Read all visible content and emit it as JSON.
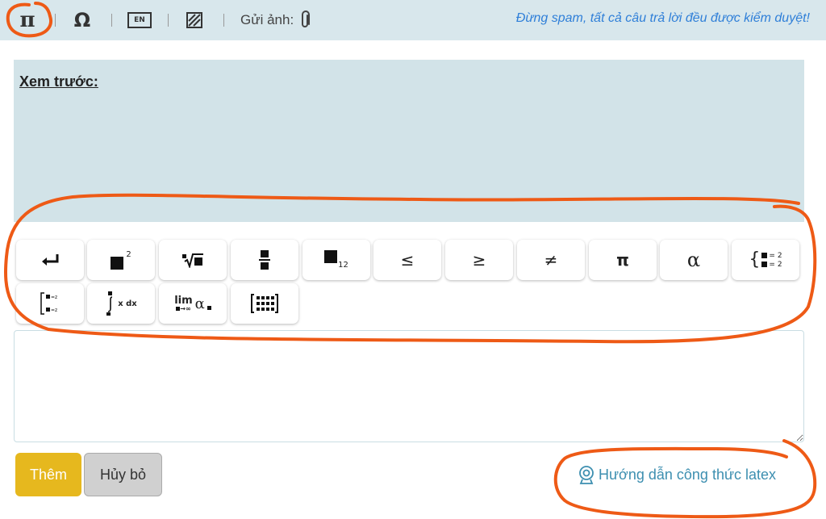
{
  "toolbar": {
    "pi_symbol": "π",
    "omega_symbol": "Ω",
    "en_label": "EN",
    "upload_label": "Gửi ảnh:",
    "notice": "Đừng spam, tất cả câu trả lời đều được kiểm duyệt!",
    "separator": "|"
  },
  "preview": {
    "label": "Xem trước:"
  },
  "math_buttons": {
    "row1": [
      "enter",
      "superscript",
      "nth-root",
      "fraction",
      "subscript",
      "≤",
      "≥",
      "≠",
      "π",
      "α",
      "system"
    ],
    "row2": [
      "matrix-2",
      "integral",
      "limit",
      "matrix"
    ],
    "le": "≤",
    "ge": "≥",
    "ne": "≠",
    "pi": "π",
    "alpha": "α",
    "sup_2": "2",
    "sub_12": "12",
    "sys_eq1": "= 2",
    "sys_eq2": "= 2",
    "int_dx": "x dx",
    "lim": "lim",
    "lim_sub": "→∞",
    "lim_alpha": "α"
  },
  "editor": {
    "value": ""
  },
  "actions": {
    "add_label": "Thêm",
    "cancel_label": "Hủy bỏ",
    "guide_label": "Hướng dẫn công thức latex"
  },
  "colors": {
    "toolbar_bg": "#d8e7ec",
    "preview_bg": "#d2e3e8",
    "notice": "#2f7fd8",
    "add_button": "#e6b81e",
    "cancel_button": "#d0d0d0",
    "guide_link": "#3d8fb0",
    "annotation": "#ee5a16"
  }
}
